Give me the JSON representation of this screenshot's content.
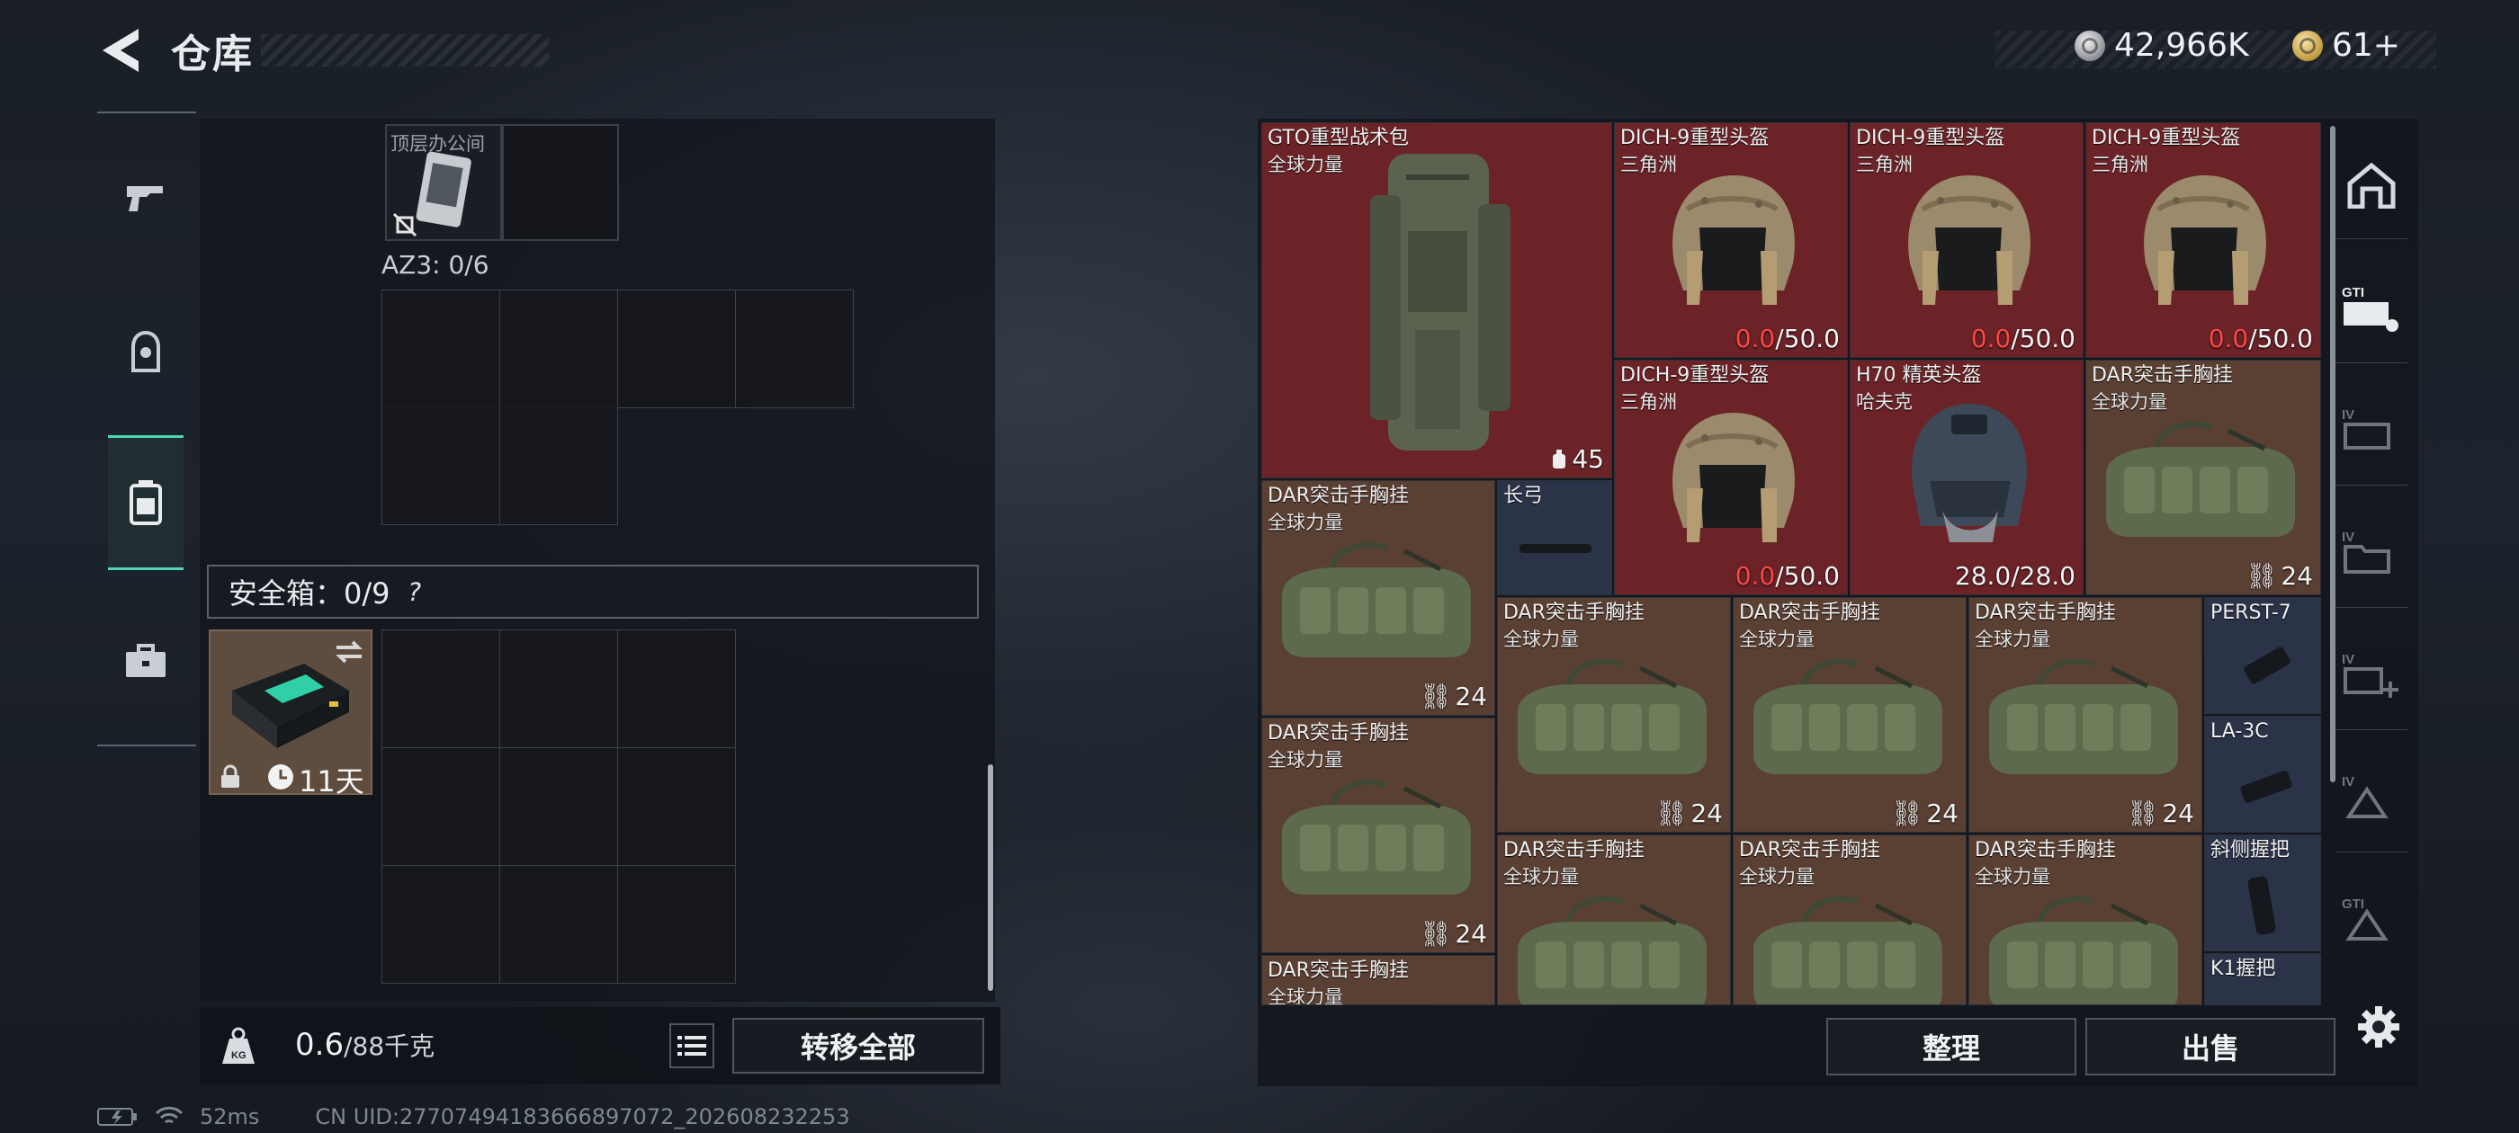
{
  "header": {
    "title": "仓库"
  },
  "currency": {
    "silver": "42,966K",
    "gold": "61+"
  },
  "left_rail": {
    "items": [
      "gun-icon",
      "helmet-icon",
      "backpack-icon",
      "briefcase-icon"
    ],
    "active": 2
  },
  "container": {
    "item_label": "顶层办公间",
    "slot_label": "AZ3: 0/6"
  },
  "safe_box": {
    "label": "安全箱：0/9",
    "help": "?",
    "timer": "11天"
  },
  "footer": {
    "weight": "0.6",
    "weight_max": "/88千克",
    "transfer_all": "转移全部"
  },
  "stash": {
    "items": [
      {
        "name": "GTO重型战术包",
        "sub": "全球力量",
        "count": "45"
      },
      {
        "name": "DICH-9重型头盔",
        "sub": "三角洲",
        "dur_cur": "0.0",
        "dur_max": "/50.0"
      },
      {
        "name": "DICH-9重型头盔",
        "sub": "三角洲",
        "dur_cur": "0.0",
        "dur_max": "/50.0"
      },
      {
        "name": "DICH-9重型头盔",
        "sub": "三角洲",
        "dur_cur": "0.0",
        "dur_max": "/50.0"
      },
      {
        "name": "DICH-9重型头盔",
        "sub": "三角洲",
        "dur_cur": "0.0",
        "dur_max": "/50.0"
      },
      {
        "name": "H70 精英头盔",
        "sub": "哈夫克",
        "dur": "28.0/28.0"
      },
      {
        "name": "DAR突击手胸挂",
        "sub": "全球力量",
        "count": "24"
      },
      {
        "name": "DAR突击手胸挂",
        "sub": "全球力量",
        "count": "24"
      },
      {
        "name": "长弓"
      },
      {
        "name": "DAR突击手胸挂",
        "sub": "全球力量",
        "count": "24"
      },
      {
        "name": "DAR突击手胸挂",
        "sub": "全球力量",
        "count": "24"
      },
      {
        "name": "DAR突击手胸挂",
        "sub": "全球力量",
        "count": "24"
      },
      {
        "name": "PERST-7"
      },
      {
        "name": "DAR突击手胸挂",
        "sub": "全球力量",
        "count": "24"
      },
      {
        "name": "LA-3C"
      },
      {
        "name": "DAR突击手胸挂",
        "sub": "全球力量"
      },
      {
        "name": "DAR突击手胸挂",
        "sub": "全球力量"
      },
      {
        "name": "DAR突击手胸挂",
        "sub": "全球力量"
      },
      {
        "name": "斜侧握把"
      },
      {
        "name": "DAR突击手胸挂",
        "sub": "全球力量"
      },
      {
        "name": "K1握把"
      }
    ],
    "sort_label": "整理",
    "sell_label": "出售"
  },
  "right_rail": {
    "items": [
      "home-icon",
      "gti-icon",
      "iv-icon",
      "iv-folder-icon",
      "iv-add-icon",
      "iv-filter-icon",
      "gti-filter-icon"
    ]
  },
  "status": {
    "ping": "52ms",
    "uid": "CN UID:27707494183666897072_202608232253"
  },
  "colors": {
    "accent": "#4fd7b3",
    "red_cell": "#6b2328",
    "brown_cell": "#5a3f33",
    "navy_cell": "#2a3348",
    "low_value": "#ff4545"
  }
}
